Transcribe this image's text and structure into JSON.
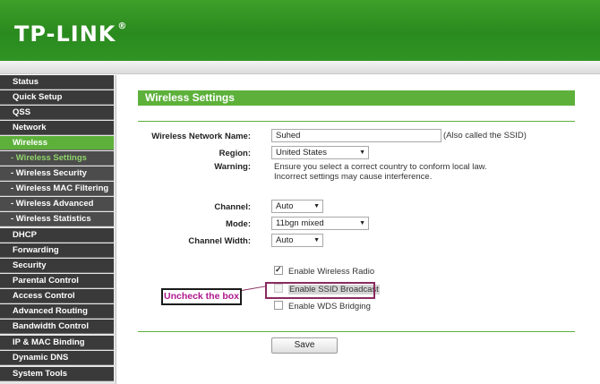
{
  "brand": {
    "logo_text": "TP-LINK",
    "reg_mark": "®"
  },
  "colors": {
    "header_green": "#2a8a1e",
    "accent_green": "#5db13b",
    "nav_dark": "#3a3a3a",
    "callout_text": "#b0188d",
    "highlight_border": "#8a2a60"
  },
  "sidebar": {
    "items": [
      {
        "label": "Status"
      },
      {
        "label": "Quick Setup"
      },
      {
        "label": "QSS"
      },
      {
        "label": "Network"
      },
      {
        "label": "Wireless"
      },
      {
        "label": "- Wireless Settings"
      },
      {
        "label": "- Wireless Security"
      },
      {
        "label": "- Wireless MAC Filtering"
      },
      {
        "label": "- Wireless Advanced"
      },
      {
        "label": "- Wireless Statistics"
      },
      {
        "label": "DHCP"
      },
      {
        "label": "Forwarding"
      },
      {
        "label": "Security"
      },
      {
        "label": "Parental Control"
      },
      {
        "label": "Access Control"
      },
      {
        "label": "Advanced Routing"
      },
      {
        "label": "Bandwidth Control"
      },
      {
        "label": "IP & MAC Binding"
      },
      {
        "label": "Dynamic DNS"
      },
      {
        "label": "System Tools"
      }
    ]
  },
  "main": {
    "title": "Wireless Settings",
    "form": {
      "ssid_label": "Wireless Network Name:",
      "ssid_value": "Suhed",
      "ssid_hint": "(Also called the SSID)",
      "region_label": "Region:",
      "region_value": "United States",
      "warning_label": "Warning:",
      "warning_line1": "Ensure you select a correct country to conform local law.",
      "warning_line2": "Incorrect settings may cause interference.",
      "channel_label": "Channel:",
      "channel_value": "Auto",
      "mode_label": "Mode:",
      "mode_value": "11bgn mixed",
      "width_label": "Channel Width:",
      "width_value": "Auto",
      "radio_label": "Enable Wireless Radio",
      "ssid_broadcast_label": "Enable SSID Broadcast",
      "wds_label": "Enable WDS Bridging",
      "save_label": "Save"
    },
    "annotation": {
      "callout_text": "Uncheck the box"
    }
  }
}
